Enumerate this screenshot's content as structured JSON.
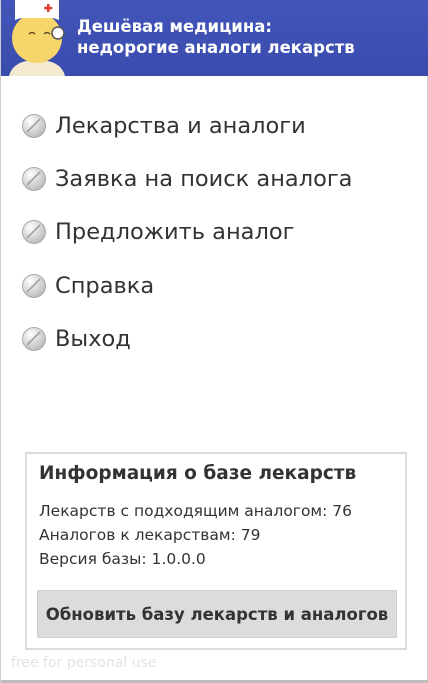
{
  "header": {
    "title_line1": "Дешёвая медицина:",
    "title_line2": "недорогие аналоги лекарств",
    "background_color": "#3f51b5",
    "logo_icon": "doctor-mascot-icon"
  },
  "menu": {
    "item_icon": "pill-icon",
    "items": [
      {
        "label": "Лекарства и аналоги"
      },
      {
        "label": "Заявка на поиск аналога"
      },
      {
        "label": "Предложить аналог"
      },
      {
        "label": "Справка"
      },
      {
        "label": "Выход"
      }
    ]
  },
  "info": {
    "title": "Информация о базе лекарств",
    "drugs_with_analog": "Лекарств с подходящим аналогом: 76",
    "analogs_count": "Аналогов к лекарствам: 79",
    "db_version": "Версия базы: 1.0.0.0",
    "update_button": "Обновить базу лекарств и аналогов"
  },
  "watermark": "free for personal use"
}
